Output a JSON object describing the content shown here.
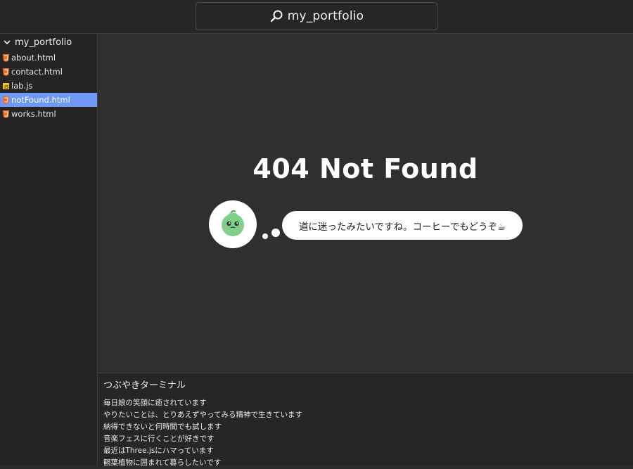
{
  "search": {
    "text": "my_portfolio"
  },
  "sidebar": {
    "folder": "my_portfolio",
    "files": [
      {
        "name": "about.html",
        "type": "html"
      },
      {
        "name": "contact.html",
        "type": "html"
      },
      {
        "name": "lab.js",
        "type": "js"
      },
      {
        "name": "notFound.html",
        "type": "html",
        "active": true
      },
      {
        "name": "works.html",
        "type": "html"
      }
    ]
  },
  "main": {
    "title": "404 Not Found",
    "bubble": "道に迷ったみたいですね。コーヒーでもどうぞ☕"
  },
  "terminal": {
    "title": "つぶやきターミナル",
    "lines": [
      "毎日娘の笑顔に癒されています",
      "やりたいことは、とりあえずやってみる精神で生きています",
      "納得できないと何時間でも試します",
      "音楽フェスに行くことが好きです",
      "最近はThree.jsにハマっています",
      "観葉植物に囲まれて暮らしたいです"
    ]
  },
  "colors": {
    "active_file": "#6f97f5",
    "html_icon": "#e8702a",
    "js_icon": "#f0c419",
    "avatar_melon": "#7fd08a"
  }
}
